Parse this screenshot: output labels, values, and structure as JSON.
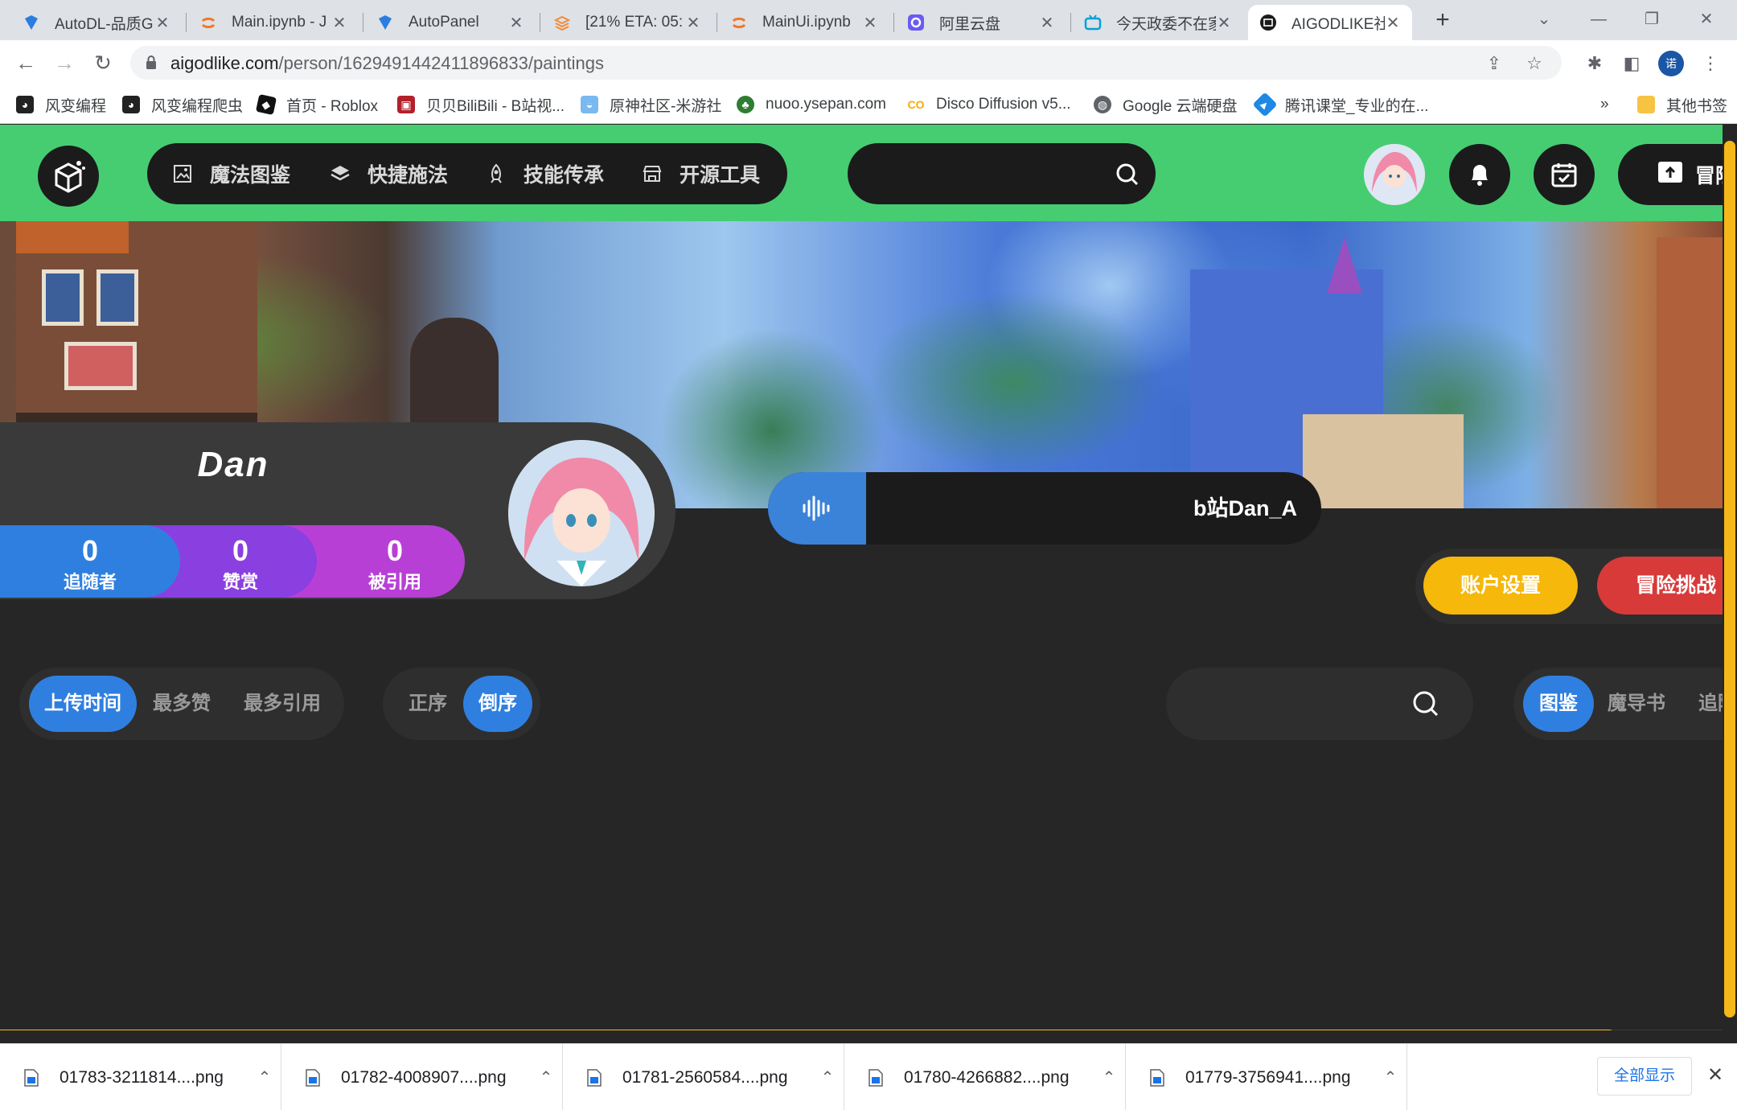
{
  "browser": {
    "tabs": [
      {
        "title": "AutoDL-品质G",
        "icon": "autodl-icon"
      },
      {
        "title": "Main.ipynb - J",
        "icon": "jupyter-icon"
      },
      {
        "title": "AutoPanel",
        "icon": "autodl-icon"
      },
      {
        "title": "[21% ETA: 05:",
        "icon": "stack-icon"
      },
      {
        "title": "MainUi.ipynb",
        "icon": "jupyter-icon"
      },
      {
        "title": "阿里云盘",
        "icon": "aliyun-drive-icon"
      },
      {
        "title": "今天政委不在家",
        "icon": "bilibili-icon"
      },
      {
        "title": "AIGODLIKE社区",
        "icon": "aigodlike-icon"
      }
    ],
    "url_host": "aigodlike.com",
    "url_path": "/person/1629491442411896833/paintings",
    "profile_initial": "诺",
    "bookmarks": [
      {
        "label": "风变编程",
        "icon": "panda-icon",
        "color": "#222222"
      },
      {
        "label": "风变编程爬虫",
        "icon": "panda-icon",
        "color": "#222222"
      },
      {
        "label": "首页 - Roblox",
        "icon": "roblox-icon",
        "color": "#111111"
      },
      {
        "label": "贝贝BiliBili - B站视...",
        "icon": "bilibili-bookmark-icon",
        "color": "#b3202a"
      },
      {
        "label": "原神社区-米游社",
        "icon": "miyoushe-icon",
        "color": "#7ab8f0"
      },
      {
        "label": "nuoo.ysepan.com",
        "icon": "tree-icon",
        "color": "#2e7d32"
      },
      {
        "label": "Disco Diffusion v5...",
        "icon": "colab-icon",
        "color": "#f9ab00"
      },
      {
        "label": "Google 云端硬盘",
        "icon": "globe-icon",
        "color": "#5f6368"
      },
      {
        "label": "腾讯课堂_专业的在...",
        "icon": "tencent-class-icon",
        "color": "#1e88e5"
      }
    ],
    "bookmarks_overflow": "»",
    "other_bookmarks": "其他书签"
  },
  "site": {
    "nav": [
      {
        "label": "魔法图鉴",
        "icon": "image-icon"
      },
      {
        "label": "快捷施法",
        "icon": "layers-icon"
      },
      {
        "label": "技能传承",
        "icon": "rocket-icon"
      },
      {
        "label": "开源工具",
        "icon": "store-icon"
      }
    ],
    "upload_label": "冒险",
    "profile": {
      "name": "Dan",
      "stats": [
        {
          "value": "0",
          "label": "追随者",
          "color": "#2f7fe0"
        },
        {
          "value": "0",
          "label": "赞赏",
          "color": "#8a3fe0"
        },
        {
          "value": "0",
          "label": "被引用",
          "color": "#b83fd6"
        }
      ],
      "music_text": "b站Dan_A"
    },
    "actions": [
      {
        "label": "账户设置",
        "color": "#f5b80b"
      },
      {
        "label": "冒险挑战",
        "color": "#d83a3a"
      }
    ],
    "sort_options": [
      {
        "label": "上传时间",
        "active": true
      },
      {
        "label": "最多赞",
        "active": false
      },
      {
        "label": "最多引用",
        "active": false
      }
    ],
    "order_options": [
      {
        "label": "正序",
        "active": false
      },
      {
        "label": "倒序",
        "active": true
      }
    ],
    "content_tabs": [
      {
        "label": "图鉴",
        "active": true
      },
      {
        "label": "魔导书",
        "active": false
      },
      {
        "label": "追随",
        "active": false
      }
    ],
    "page_progress": 0.93
  },
  "downloads": [
    "01783-3211814....png",
    "01782-4008907....png",
    "01781-2560584....png",
    "01780-4266882....png",
    "01779-3756941....png"
  ],
  "downloads_show_all": "全部显示"
}
